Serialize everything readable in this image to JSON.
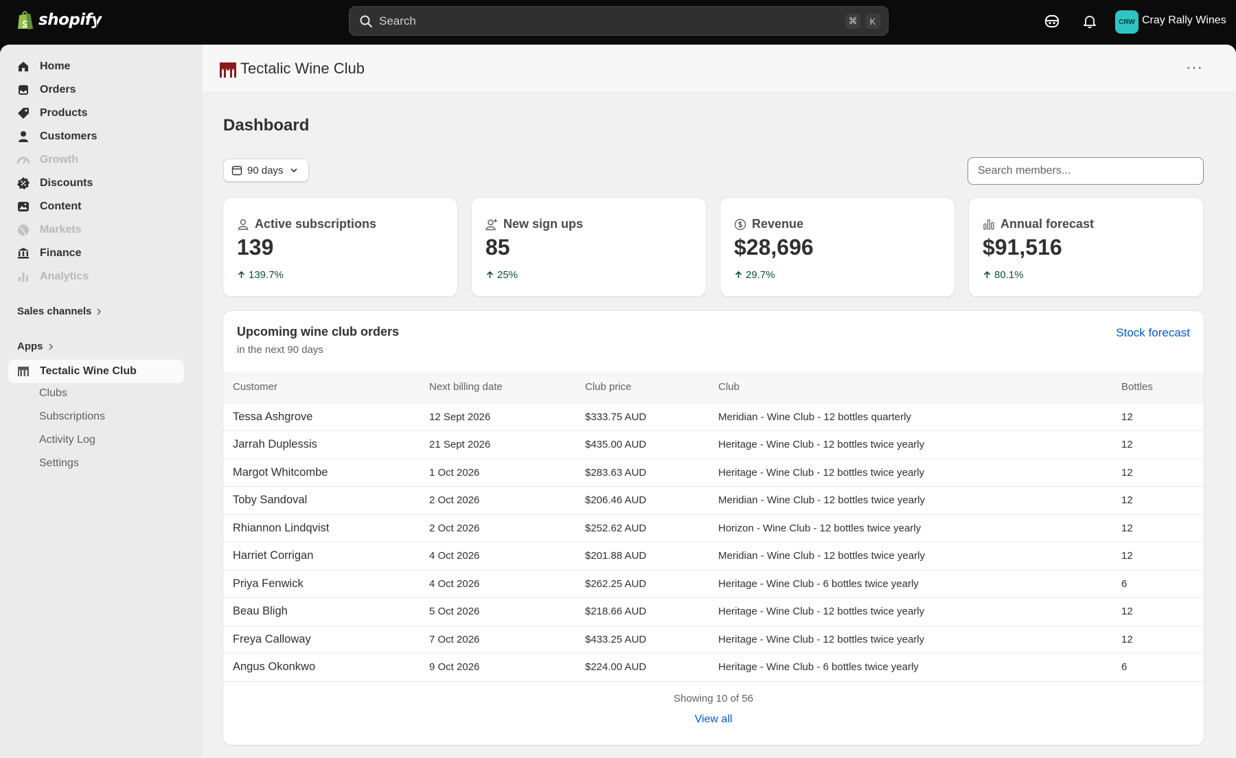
{
  "topbar": {
    "brand": "shopify",
    "search_placeholder": "Search",
    "shortcut_cmd": "⌘",
    "shortcut_key": "K",
    "store_initials": "CRW",
    "store_name": "Cray Rally Wines"
  },
  "sidebar": {
    "items": [
      {
        "label": "Home",
        "icon": "home-icon",
        "disabled": false
      },
      {
        "label": "Orders",
        "icon": "inbox-icon",
        "disabled": false
      },
      {
        "label": "Products",
        "icon": "tag-icon",
        "disabled": false
      },
      {
        "label": "Customers",
        "icon": "person-icon",
        "disabled": false
      },
      {
        "label": "Growth",
        "icon": "gauge-icon",
        "disabled": true
      },
      {
        "label": "Discounts",
        "icon": "discount-icon",
        "disabled": false
      },
      {
        "label": "Content",
        "icon": "image-icon",
        "disabled": false
      },
      {
        "label": "Markets",
        "icon": "globe-icon",
        "disabled": true
      },
      {
        "label": "Finance",
        "icon": "bank-icon",
        "disabled": false
      },
      {
        "label": "Analytics",
        "icon": "bar-chart-icon",
        "disabled": true
      }
    ],
    "sales_channels_label": "Sales channels",
    "apps_label": "Apps",
    "app_active_label": "Tectalic Wine Club",
    "app_sub_items": [
      "Clubs",
      "Subscriptions",
      "Activity Log",
      "Settings"
    ]
  },
  "app": {
    "title": "Tectalic Wine Club",
    "more_label": "···"
  },
  "dashboard": {
    "title": "Dashboard",
    "date_range": "90 days",
    "member_search_placeholder": "Search members...",
    "stats": [
      {
        "label": "Active subscriptions",
        "value": "139",
        "change": "139.7%",
        "icon": "person-icon"
      },
      {
        "label": "New sign ups",
        "value": "85",
        "change": "25%",
        "icon": "person-add-icon"
      },
      {
        "label": "Revenue",
        "value": "$28,696",
        "change": "29.7%",
        "icon": "dollar-circle-icon"
      },
      {
        "label": "Annual forecast",
        "value": "$91,516",
        "change": "80.1%",
        "icon": "bar-chart-icon"
      }
    ]
  },
  "orders": {
    "title": "Upcoming wine club orders",
    "subtitle": "in the next 90 days",
    "stock_link": "Stock forecast",
    "columns": [
      "Customer",
      "Next billing date",
      "Club price",
      "Club",
      "Bottles"
    ],
    "rows": [
      [
        "Tessa Ashgrove",
        "12 Sept 2026",
        "$333.75 AUD",
        "Meridian - Wine Club - 12 bottles quarterly",
        "12"
      ],
      [
        "Jarrah Duplessis",
        "21 Sept 2026",
        "$435.00 AUD",
        "Heritage - Wine Club - 12 bottles twice yearly",
        "12"
      ],
      [
        "Margot Whitcombe",
        "1 Oct 2026",
        "$283.63 AUD",
        "Heritage - Wine Club - 12 bottles twice yearly",
        "12"
      ],
      [
        "Toby Sandoval",
        "2 Oct 2026",
        "$206.46 AUD",
        "Meridian - Wine Club - 12 bottles twice yearly",
        "12"
      ],
      [
        "Rhiannon Lindqvist",
        "2 Oct 2026",
        "$252.62 AUD",
        "Horizon - Wine Club - 12 bottles twice yearly",
        "12"
      ],
      [
        "Harriet Corrigan",
        "4 Oct 2026",
        "$201.88 AUD",
        "Meridian - Wine Club - 12 bottles twice yearly",
        "12"
      ],
      [
        "Priya Fenwick",
        "4 Oct 2026",
        "$262.25 AUD",
        "Heritage - Wine Club - 6 bottles twice yearly",
        "6"
      ],
      [
        "Beau Bligh",
        "5 Oct 2026",
        "$218.66 AUD",
        "Heritage - Wine Club - 12 bottles twice yearly",
        "12"
      ],
      [
        "Freya Calloway",
        "7 Oct 2026",
        "$433.25 AUD",
        "Heritage - Wine Club - 12 bottles twice yearly",
        "12"
      ],
      [
        "Angus Okonkwo",
        "9 Oct 2026",
        "$224.00 AUD",
        "Heritage - Wine Club - 6 bottles twice yearly",
        "6"
      ]
    ],
    "showing": "Showing 10 of 56",
    "view_all": "View all"
  },
  "colors": {
    "topbar_bg": "#0b0b0b",
    "link": "#005bd3",
    "positive": "#0c5132",
    "avatar": "#2ec4c4",
    "app_logo": "#8b1a1a"
  }
}
